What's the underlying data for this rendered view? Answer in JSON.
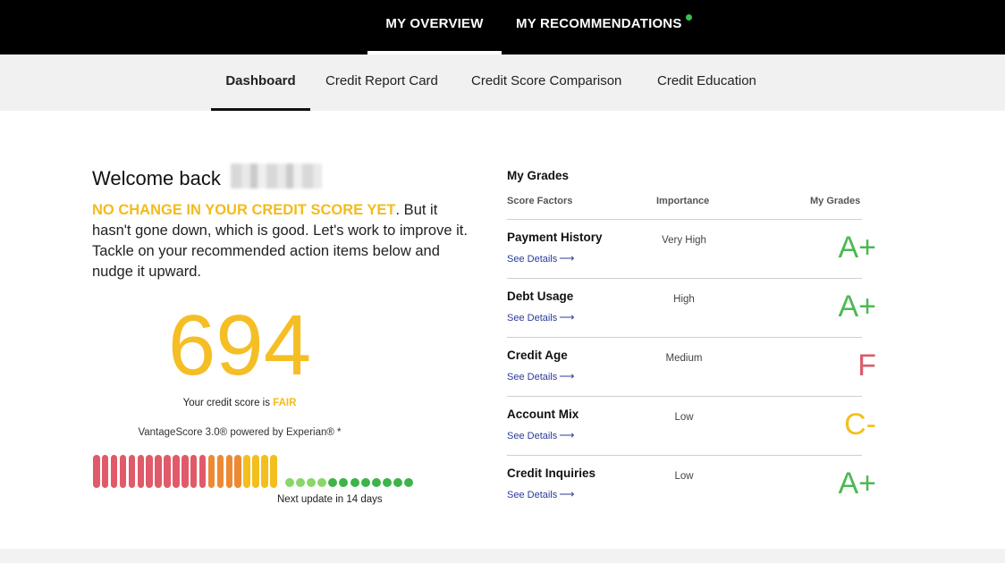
{
  "header": {
    "nav": [
      {
        "label": "MY OVERVIEW",
        "active": true
      },
      {
        "label": "MY RECOMMENDATIONS",
        "active": false,
        "has_notification": true
      }
    ],
    "notification_color": "#3cbe4b"
  },
  "subnav": {
    "tabs": [
      {
        "label": "Dashboard",
        "active": true
      },
      {
        "label": "Credit Report Card",
        "active": false
      },
      {
        "label": "Credit Score Comparison",
        "active": false
      },
      {
        "label": "Credit Education",
        "active": false
      }
    ]
  },
  "welcome": {
    "greeting": "Welcome back",
    "headline": "NO CHANGE IN YOUR CREDIT SCORE YET",
    "body": ". But it hasn't gone down, which is good. Let's work to improve it. Tackle on your recommended action items below and nudge it upward."
  },
  "score": {
    "value": "694",
    "caption_prefix": "Your credit score is ",
    "rating": "FAIR",
    "model": "VantageScore 3.0® powered by Experian® *",
    "next_update": "Next update in 14 days",
    "colors": {
      "score": "#f5be24",
      "accent": "#f3bb1c"
    },
    "gauge": {
      "bars_red": 13,
      "bars_orange": 4,
      "bars_yellow": 4,
      "dots_light_green": 4,
      "dots_green": 8,
      "colors": {
        "red": "#e05a6a",
        "orange": "#ec8a34",
        "yellow": "#f3bf1e",
        "light_green": "#8ad66a",
        "green": "#3db34a"
      }
    }
  },
  "grades": {
    "title": "My Grades",
    "columns": [
      "Score Factors",
      "Importance",
      "My Grades"
    ],
    "details_label": "See Details",
    "rows": [
      {
        "factor": "Payment History",
        "importance": "Very High",
        "grade": "A+",
        "color": "#4cb852"
      },
      {
        "factor": "Debt Usage",
        "importance": "High",
        "grade": "A+",
        "color": "#4cb852"
      },
      {
        "factor": "Credit Age",
        "importance": "Medium",
        "grade": "F",
        "color": "#dc5a6b"
      },
      {
        "factor": "Account Mix",
        "importance": "Low",
        "grade": "C-",
        "color": "#f3bf1e"
      },
      {
        "factor": "Credit Inquiries",
        "importance": "Low",
        "grade": "A+",
        "color": "#4cb852"
      }
    ]
  }
}
